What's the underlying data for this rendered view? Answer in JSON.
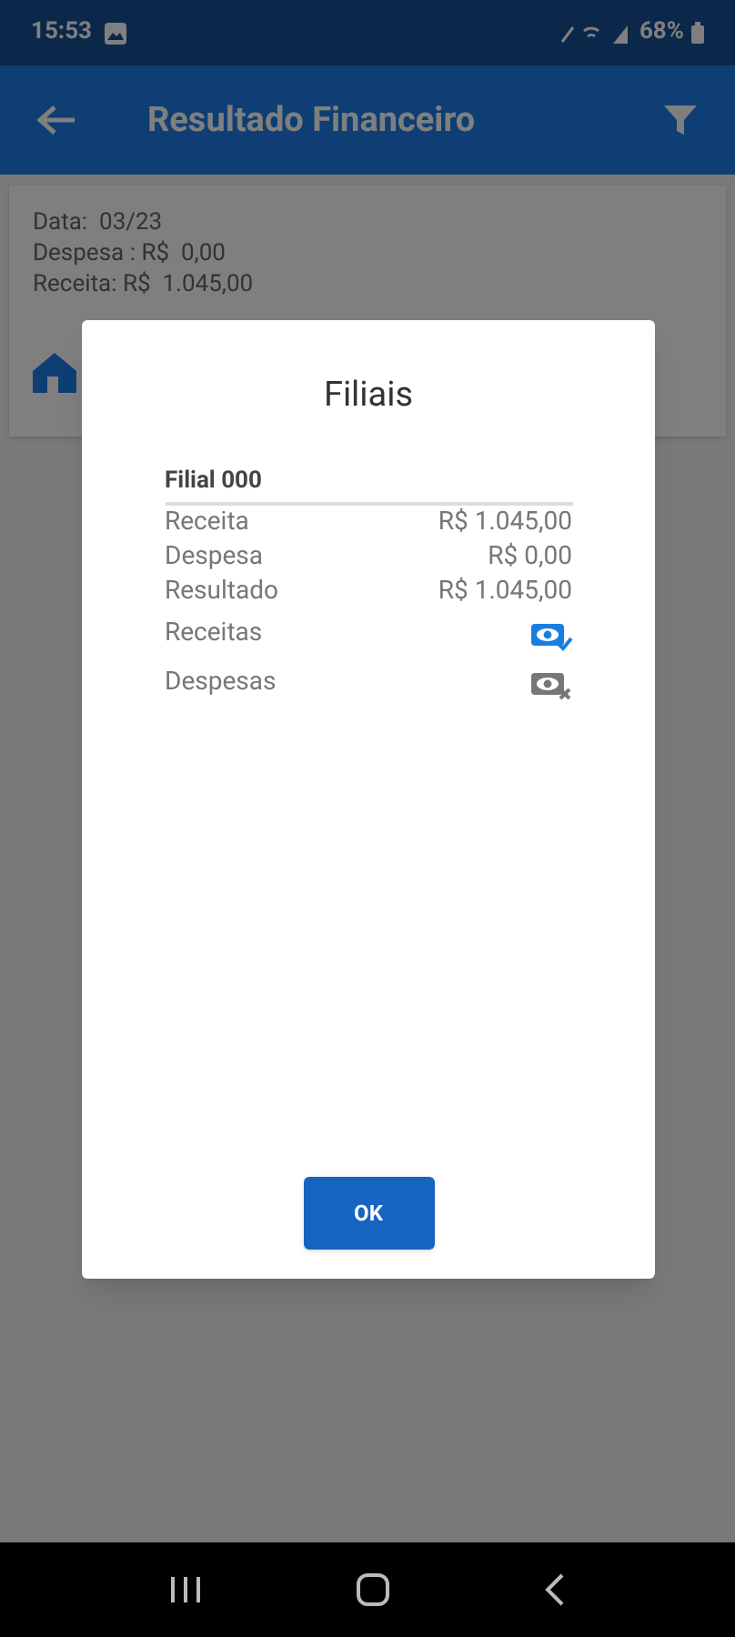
{
  "status_bar": {
    "time": "15:53",
    "battery": "68%"
  },
  "app_bar": {
    "title": "Resultado Financeiro"
  },
  "summary_card": {
    "lines": [
      "Data:  03/23",
      "Despesa : R$  0,00",
      "Receita: R$  1.045,00"
    ]
  },
  "dialog": {
    "title": "Filiais",
    "branch": "Filial 000",
    "rows": [
      {
        "label": "Receita",
        "value": "R$ 1.045,00"
      },
      {
        "label": "Despesa",
        "value": "R$ 0,00"
      },
      {
        "label": "Resultado",
        "value": "R$ 1.045,00"
      }
    ],
    "toggles": [
      {
        "label": "Receitas",
        "on": true
      },
      {
        "label": "Despesas",
        "on": false
      }
    ],
    "button": "OK"
  }
}
